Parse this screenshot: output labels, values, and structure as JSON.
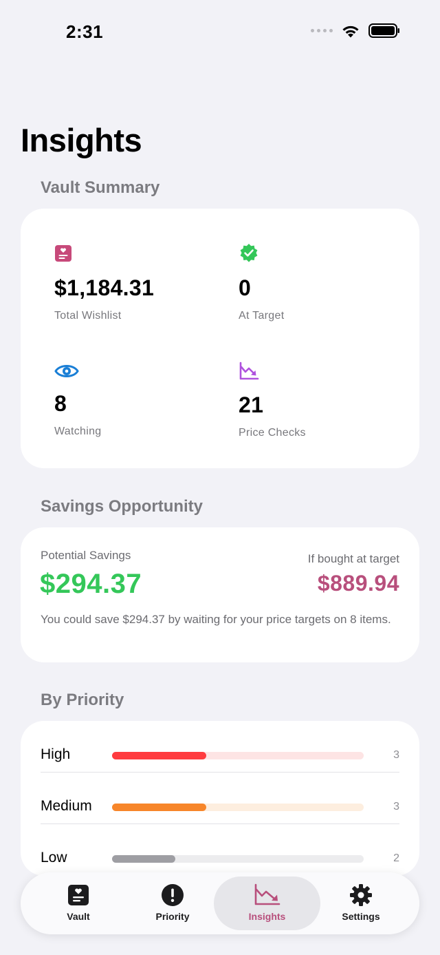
{
  "status": {
    "time": "2:31"
  },
  "page": {
    "title": "Insights"
  },
  "vault_summary": {
    "header": "Vault Summary",
    "stats": [
      {
        "icon": "wishlist-icon",
        "value": "$1,184.31",
        "label": "Total Wishlist",
        "color": "#c7497a"
      },
      {
        "icon": "verified-badge-icon",
        "value": "0",
        "label": "At Target",
        "color": "#34c759"
      },
      {
        "icon": "eye-icon",
        "value": "8",
        "label": "Watching",
        "color": "#1a7fd6"
      },
      {
        "icon": "chart-down-icon",
        "value": "21",
        "label": "Price Checks",
        "color": "#af52de"
      }
    ]
  },
  "savings": {
    "header": "Savings Opportunity",
    "potential_label": "Potential Savings",
    "potential_value": "$294.37",
    "target_label": "If bought at target",
    "target_value": "$889.94",
    "description": "You could save $294.37 by waiting for your price targets on 8 items."
  },
  "priority": {
    "header": "By Priority",
    "rows": [
      {
        "label": "High",
        "count": "3",
        "fraction": 0.375,
        "fill": "#ff3b3f",
        "track": "#fde4e4"
      },
      {
        "label": "Medium",
        "count": "3",
        "fraction": 0.375,
        "fill": "#f7862a",
        "track": "#fdeedf"
      },
      {
        "label": "Low",
        "count": "2",
        "fraction": 0.25,
        "fill": "#9e9ea3",
        "track": "#ececee"
      }
    ]
  },
  "tab_bar": {
    "tabs": [
      {
        "label": "Vault",
        "icon": "vault-icon"
      },
      {
        "label": "Priority",
        "icon": "exclamation-icon"
      },
      {
        "label": "Insights",
        "icon": "chart-down-icon",
        "active": true
      },
      {
        "label": "Settings",
        "icon": "gear-icon"
      }
    ],
    "accent": "#b84f7c"
  }
}
